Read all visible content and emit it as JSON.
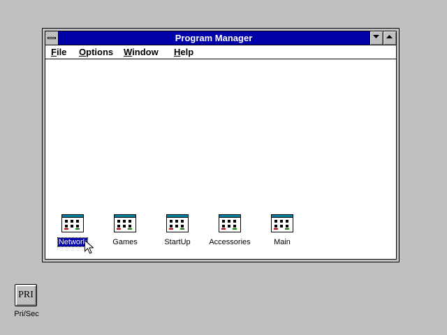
{
  "window": {
    "title": "Program Manager",
    "menu": [
      {
        "label": "File",
        "mnemonic": "F",
        "rest": "ile"
      },
      {
        "label": "Options",
        "mnemonic": "O",
        "rest": "ptions"
      },
      {
        "label": "Window",
        "mnemonic": "W",
        "rest": "indow"
      },
      {
        "label": "Help",
        "mnemonic": "H",
        "rest": "elp"
      }
    ],
    "buttons": {
      "system_menu_icon": "system-menu-icon",
      "minimize_icon": "minimize-arrow-icon",
      "maximize_icon": "maximize-arrow-icon"
    }
  },
  "groups": [
    {
      "label": "Network",
      "selected": true,
      "icon": "program-group-icon"
    },
    {
      "label": "Games",
      "selected": false,
      "icon": "program-group-icon"
    },
    {
      "label": "StartUp",
      "selected": false,
      "icon": "program-group-icon"
    },
    {
      "label": "Accessories",
      "selected": false,
      "icon": "program-group-icon"
    },
    {
      "label": "Main",
      "selected": false,
      "icon": "program-group-icon"
    }
  ],
  "desktop_icons": [
    {
      "button_text": "PRI",
      "caption": "Pri/Sec"
    }
  ],
  "colors": {
    "desktop": "#c0c0c0",
    "titlebar_active": "#0000a8",
    "selection": "#0000a8"
  }
}
